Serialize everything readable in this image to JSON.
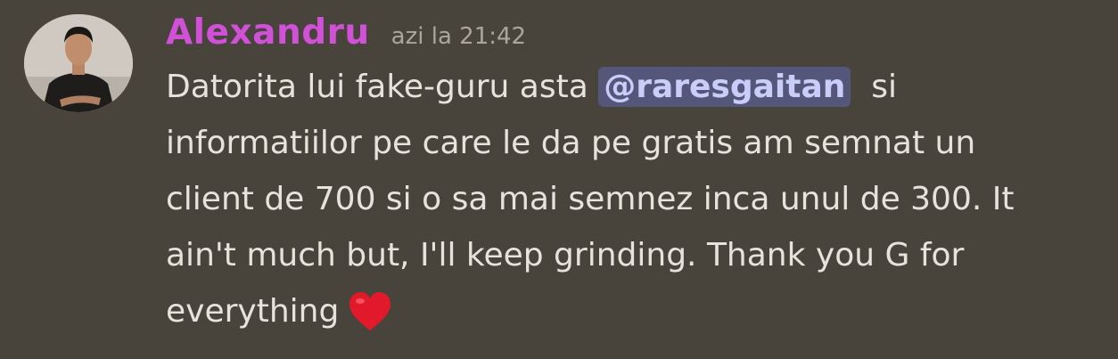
{
  "message": {
    "author": "Alexandru",
    "timestamp": "azi la 21:42",
    "text_before_mention": "Datorita lui fake-guru asta ",
    "mention": "@raresgaitan",
    "text_line_1_end": "  si",
    "text_line_2": "informatiilor pe care le da pe gratis am semnat un",
    "text_line_3": "client de 700 si o sa mai semnez inca unul de 300. It",
    "text_line_4": "ain't much but, I'll keep grinding. Thank you G for",
    "text_line_5": "everything",
    "emoji": "heart-emoji"
  },
  "colors": {
    "background": "#49443b",
    "username": "#d150d8",
    "timestamp": "#aaa69c",
    "text": "#e6e3dd",
    "mention_bg": "#55577a",
    "mention_text": "#c9cdf9",
    "heart": "#e2182b"
  }
}
